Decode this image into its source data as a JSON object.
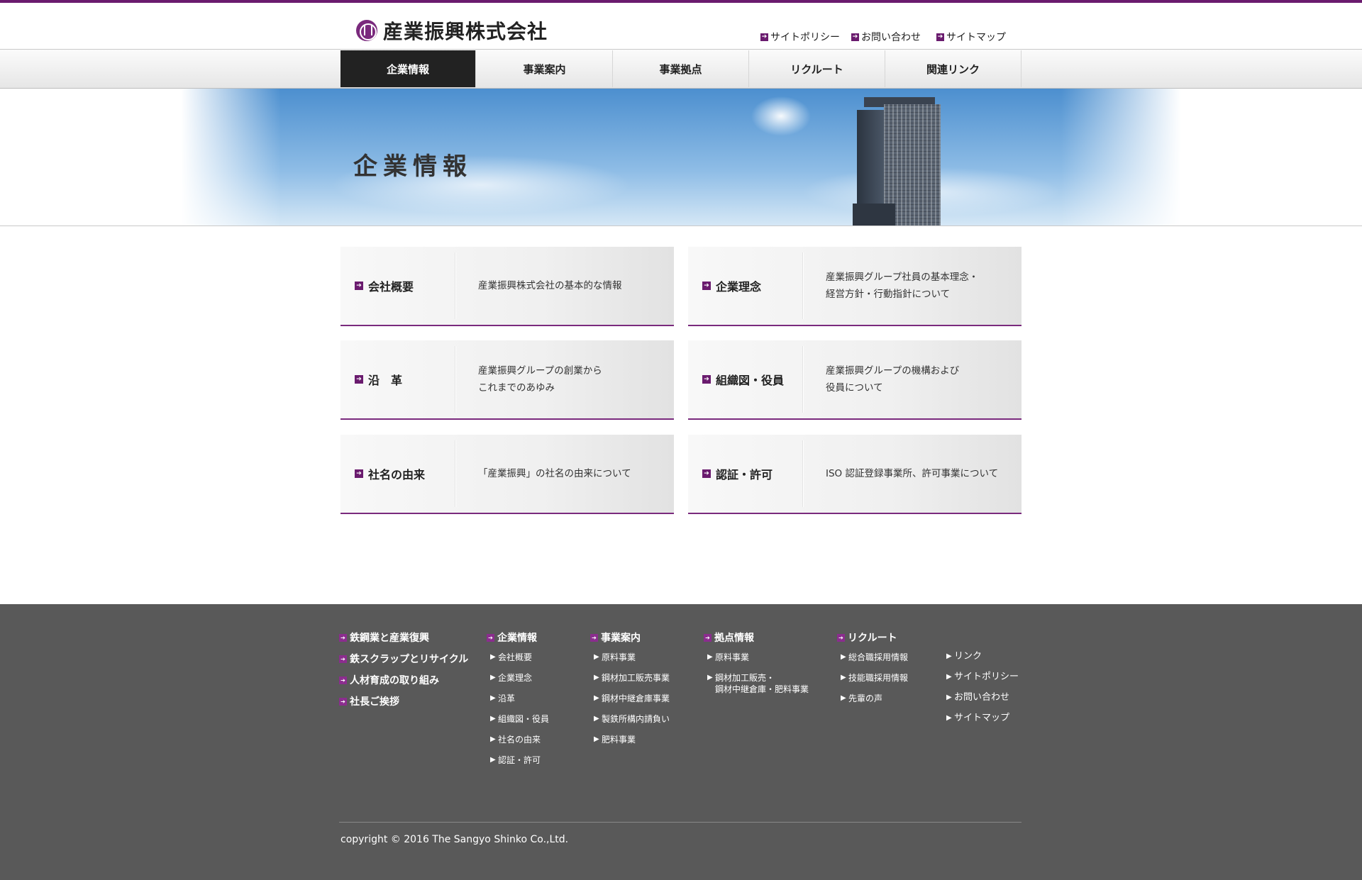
{
  "header": {
    "company_name": "産業振興株式会社",
    "util_links": [
      "サイトポリシー",
      "お問い合わせ",
      "サイトマップ"
    ]
  },
  "nav": {
    "items": [
      "企業情報",
      "事業案内",
      "事業拠点",
      "リクルート",
      "関連リンク"
    ],
    "active": "企業情報"
  },
  "hero": {
    "title": "企業情報"
  },
  "cards": [
    {
      "title": "会社概要",
      "desc": "産業振興株式会社の基本的な情報"
    },
    {
      "title": "企業理念",
      "desc": "産業振興グループ社員の基本理念・\n経営方針・行動指針について"
    },
    {
      "title": "沿　革",
      "desc": "産業振興グループの創業から\nこれまでのあゆみ"
    },
    {
      "title": "組織図・役員",
      "desc": "産業振興グループの機構および\n役員について"
    },
    {
      "title": "社名の由来",
      "desc": "「産業振興」の社名の由来について"
    },
    {
      "title": "認証・許可",
      "desc": "ISO 認証登録事業所、許可事業について"
    }
  ],
  "footer": {
    "col1": [
      "鉄鋼業と産業復興",
      "鉄スクラップとリサイクル",
      "人材育成の取り組み",
      "社長ご挨拶"
    ],
    "col2": {
      "head": "企業情報",
      "items": [
        "会社概要",
        "企業理念",
        "沿革",
        "組織図・役員",
        "社名の由来",
        "認証・許可"
      ]
    },
    "col3": {
      "head": "事業案内",
      "items": [
        "原料事業",
        "鋼材加工販売事業",
        "鋼材中継倉庫事業",
        "製鉄所構内請負い",
        "肥料事業"
      ]
    },
    "col4": {
      "head": "拠点情報",
      "items": [
        "原料事業",
        "鋼材加工販売・\n鋼材中継倉庫・肥料事業"
      ]
    },
    "col5": {
      "head": "リクルート",
      "items": [
        "総合職採用情報",
        "技能職採用情報",
        "先輩の声"
      ]
    },
    "col6": [
      "リンク",
      "サイトポリシー",
      "お問い合わせ",
      "サイトマップ"
    ],
    "copyright": "copyright © 2016 The Sangyo Shinko Co.,Ltd."
  },
  "colors": {
    "accent": "#6a1b6e",
    "footer_bg": "#595959",
    "nav_active": "#222222"
  },
  "icons": {
    "link_arrow": "arrow-right-icon",
    "sub_bullet": "triangle-right-icon"
  }
}
